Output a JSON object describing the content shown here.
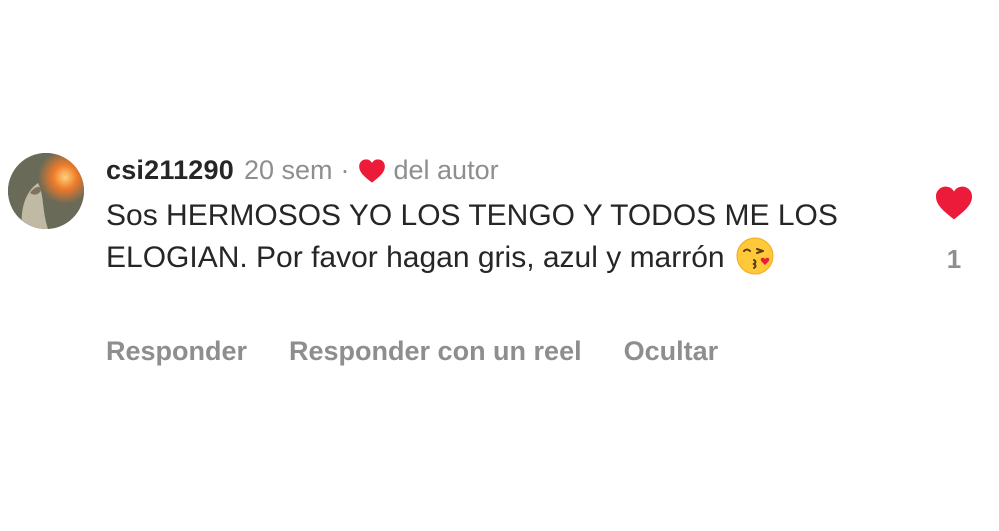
{
  "comment": {
    "username": "csi211290",
    "time": "20 sem",
    "separator": "·",
    "author_like_label": "del autor",
    "text": "Sos HERMOSOS YO LOS TENGO Y TODOS ME LOS ELOGIAN. Por favor hagan gris, azul y marrón",
    "emoji_icon": "face-blowing-kiss-icon",
    "like_count": "1",
    "like_color": "#ed1b3a"
  },
  "actions": {
    "reply_label": "Responder",
    "reply_reel_label": "Responder con un reel",
    "hide_label": "Ocultar"
  },
  "colors": {
    "text_primary": "#262626",
    "text_secondary": "#8e8e8e",
    "heart_red": "#ed1b3a"
  }
}
